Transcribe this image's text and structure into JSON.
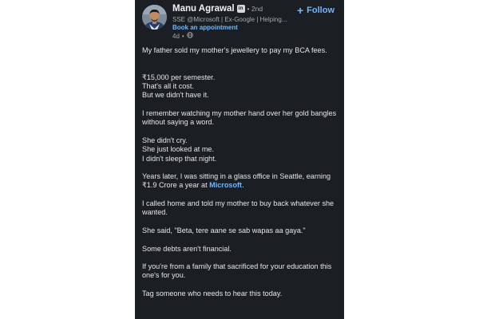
{
  "author": {
    "name": "Manu Agrawal",
    "badge": "in",
    "degree": "• 2nd",
    "headline": "SSE @Microsoft | Ex-Google | Helping...",
    "booking": "Book an appointment",
    "time": "4d",
    "time_separator": "•",
    "visibility_icon": "globe-icon"
  },
  "follow": {
    "plus": "+",
    "label": "Follow"
  },
  "post": {
    "p1": "My father sold my mother's jewellery to pay my BCA fees.",
    "p2_l1": "₹15,000 per semester.",
    "p2_l2": "That's all it cost.",
    "p2_l3": "But we didn't have it.",
    "p3": "I remember watching my mother hand over her gold bangles without saying a word.",
    "p4_l1": "She didn't cry.",
    "p4_l2": "She just looked at me.",
    "p4_l3": "I didn't sleep that night.",
    "p5_before": "Years later, I was sitting in a glass office in Seattle, earning ₹1.9 Crore a year at ",
    "p5_mention": "Microsoft",
    "p5_after": ".",
    "p6": "I called home and told my mother to buy back whatever she wanted.",
    "p7": "She said, \"Beta, tere aane se sab wapas aa gaya.\"",
    "p8": "Some debts aren't financial.",
    "p9": "If you're from a family that sacrificed for your education this one's for you.",
    "p10": "Tag someone who needs to hear this today."
  },
  "colors": {
    "background": "#1b1f23",
    "accent": "#71b7fb",
    "text": "#e6e6e6",
    "muted": "#a7a9ab"
  }
}
